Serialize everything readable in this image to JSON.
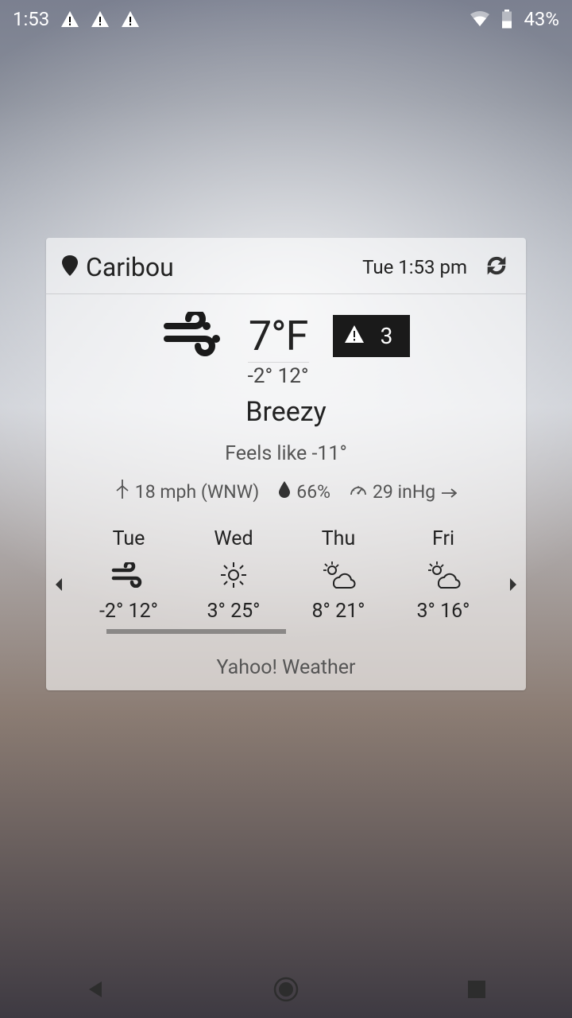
{
  "status": {
    "time": "1:53",
    "batt": "43%"
  },
  "header": {
    "location": "Caribou",
    "datetime": "Tue 1:53 pm"
  },
  "now": {
    "temp": "7°F",
    "lo": "-2°",
    "hi": "12°",
    "alert_count": "3",
    "cond": "Breezy",
    "feels": "Feels like -11°"
  },
  "details": {
    "wind": "18 mph (WNW)",
    "humidity": "66%",
    "pressure": "29 inHg"
  },
  "forecast": [
    {
      "day": "Tue",
      "icon": "wind",
      "lo": "-2°",
      "hi": "12°"
    },
    {
      "day": "Wed",
      "icon": "sun",
      "lo": "3°",
      "hi": "25°"
    },
    {
      "day": "Thu",
      "icon": "partly",
      "lo": "8°",
      "hi": "21°"
    },
    {
      "day": "Fri",
      "icon": "partly",
      "lo": "3°",
      "hi": "16°"
    }
  ],
  "footer": "Yahoo! Weather"
}
